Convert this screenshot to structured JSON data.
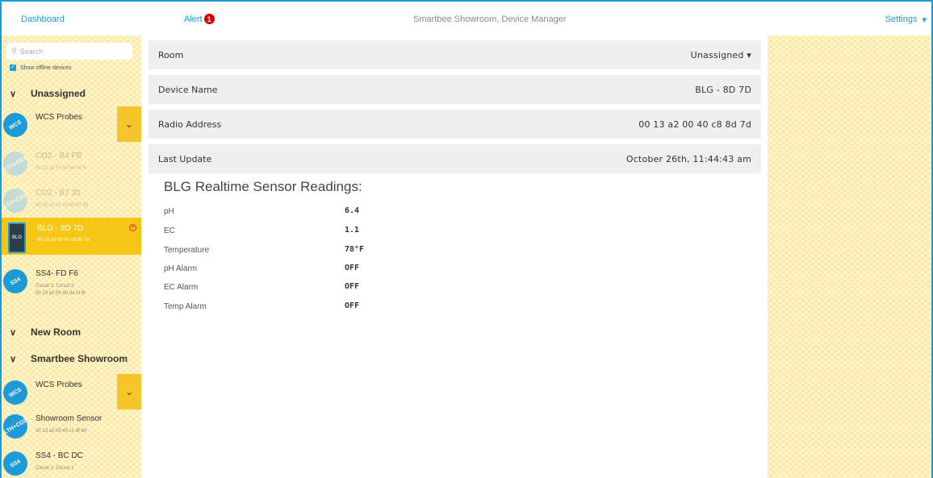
{
  "topbar": {
    "dashboard": "Dashboard",
    "alert": "Alert",
    "alert_count": "1",
    "title": "Smartbee Showroom, Device Manager",
    "settings": "Settings",
    "settings_caret": "▾"
  },
  "sidebar": {
    "search_placeholder": "Search",
    "show_offline": "Show offline devices",
    "groups": [
      {
        "name": "Unassigned"
      },
      {
        "name": "New Room"
      },
      {
        "name": "Smartbee Showroom"
      }
    ],
    "unassigned_devices": [
      {
        "name": "WCS Probes",
        "icon": "WCS",
        "sub1": "",
        "sub2": ""
      },
      {
        "name": "CO2 - B4 FB",
        "icon": "LTH+CO2",
        "sub1": "00 13 a2 00 40 b4 b4 fb",
        "sub2": ""
      },
      {
        "name": "CO2 - B7 35",
        "icon": "LTH+CO2",
        "sub1": "00 13 a2 00 40 b4 b7 35",
        "sub2": ""
      },
      {
        "name": "BLG - 8D 7D",
        "icon": "BLG",
        "sub1": "00 13 a2 00 40 c8 8d 7d",
        "sub2": ""
      },
      {
        "name": "SS4- FD F6",
        "icon": "SS4",
        "sub1": "Circuit 3: Circuit 3",
        "sub2": "00 13 a2 00 40 da fd f6"
      }
    ],
    "showroom_devices": [
      {
        "name": "WCS Probes",
        "icon": "WCS",
        "sub1": "",
        "sub2": ""
      },
      {
        "name": "Showroom Sensor",
        "icon": "LTH+CO2",
        "sub1": "00 13 a2 00 40 c1 9f 60",
        "sub2": ""
      },
      {
        "name": "SS4 - BC DC",
        "icon": "SS4",
        "sub1": "Circuit 1: Circuit 1",
        "sub2": ""
      }
    ]
  },
  "main": {
    "rows": [
      {
        "label": "Room",
        "value": "Unassigned ▾"
      },
      {
        "label": "Device Name",
        "value": "BLG - 8D 7D"
      },
      {
        "label": "Radio Address",
        "value": "00 13 a2 00 40 c8 8d 7d"
      },
      {
        "label": "Last Update",
        "value": "October 26th, 11:44:43 am"
      }
    ],
    "readings_title": "BLG Realtime Sensor Readings:",
    "readings": [
      {
        "label": "pH",
        "value": "6.4"
      },
      {
        "label": "EC",
        "value": "1.1"
      },
      {
        "label": "Temperature",
        "value": "78°F"
      },
      {
        "label": "pH Alarm",
        "value": "OFF"
      },
      {
        "label": "EC Alarm",
        "value": "OFF"
      },
      {
        "label": "Temp Alarm",
        "value": "OFF"
      }
    ]
  },
  "colors": {
    "accent": "#1e9bd7",
    "honeycomb": "#fbe58f",
    "selected": "#f7c614",
    "alert": "#d40000"
  }
}
